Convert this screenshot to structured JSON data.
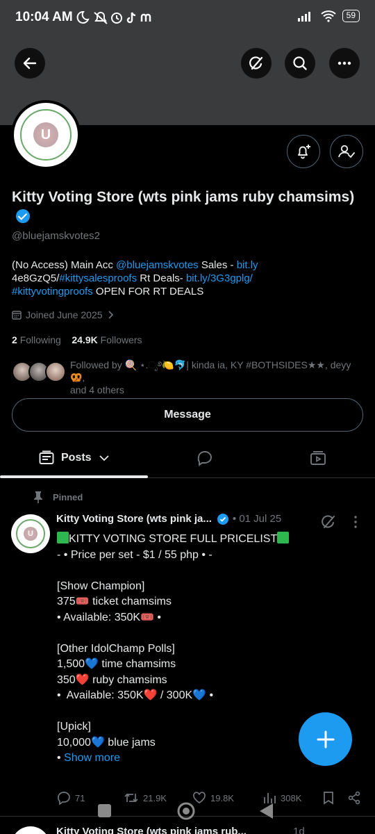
{
  "status_bar": {
    "time": "10:04 AM",
    "battery": "59",
    "icons": [
      "moon-icon",
      "muted-bell-icon",
      "alarm-icon",
      "tiktok-icon",
      "app-icon",
      "signal-icon",
      "wifi-icon"
    ]
  },
  "header_icons": [
    "back-arrow-icon",
    "grok-icon",
    "search-icon",
    "more-icon"
  ],
  "profile": {
    "display_name": "Kitty Voting Store (wts pink jams ruby chamsims)",
    "handle": "@bluejamskvotes2",
    "bio_part1": "(No Access) Main Acc ",
    "bio_mention": "@bluejamskvotes",
    "bio_part2": " Sales - ",
    "bio_link1": "bit.ly",
    "bio_part3": "4e8GzQ5/",
    "bio_hashtag1": "#kittysalesproofs",
    "bio_part4": " Rt Deals- ",
    "bio_link2": "bit.ly/3G3gplg/",
    "bio_hashtag2": "#kittyvotingproofs",
    "bio_part5": " OPEN FOR RT DEALS",
    "joined": "Joined June 2025",
    "following_count": "2",
    "following_label": "Following",
    "followers_count": "24.9K",
    "followers_label": "Followers",
    "followed_by_prefix": "Followed by ",
    "followed_by_names": "🍭 ⋆.ೃ࿔🍋🐬| kinda ia, KY #BOTHSIDES★★, deyy 🥨,",
    "followed_by_suffix": "and 4 others",
    "avatar_text": "U",
    "message_button": "Message"
  },
  "tabs": [
    {
      "label": "Posts",
      "icon": "posts-icon",
      "active": true
    },
    {
      "label": "",
      "icon": "replies-icon",
      "active": false
    },
    {
      "label": "",
      "icon": "media-icon",
      "active": false
    }
  ],
  "pinned_post": {
    "pinned_label": "Pinned",
    "author": "Kitty Voting Store (wts pink ja...",
    "time": "• 01 Jul 25",
    "body_title": "KITTY VOTING STORE FULL PRICELIST",
    "body": "\n- • Price per set - $1 / 55 php • -\n\n[Show Champion]\n375🎟️ ticket chamsims\n• Available: 350K🎟️ •\n\n[Other IdolChamp Polls]\n1,500💙 time chamsims\n350❤️ ruby chamsims\n•  Available: 350K❤️ / 300K💙 •\n\n[Upick]\n10,000💙 blue jams\n• ",
    "show_more": "Show more",
    "replies": "71",
    "reposts": "21.9K",
    "likes": "19.8K",
    "views": "308K"
  },
  "next_post": {
    "author": "Kitty Voting Store (wts pink jams rub...",
    "time": "1d"
  },
  "colors": {
    "accent": "#1d9bf0",
    "background": "#000000",
    "banner": "#3a3b3d",
    "secondary_text": "#71767b"
  }
}
